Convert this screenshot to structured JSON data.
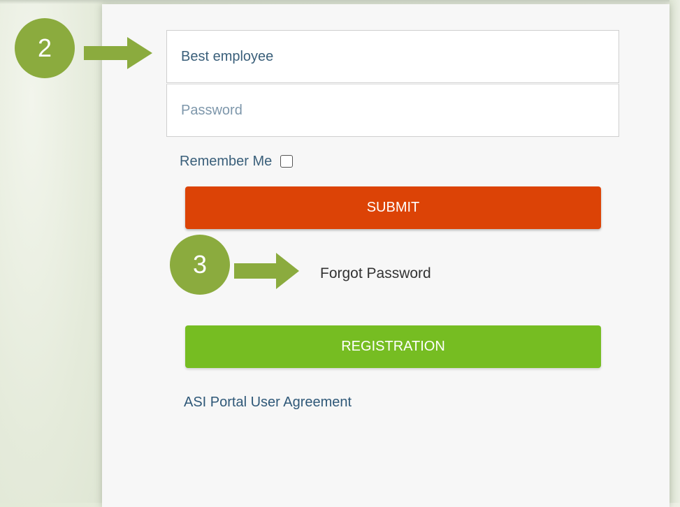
{
  "login_form": {
    "username_value": "Best employee",
    "password_placeholder": "Password",
    "remember_label": "Remember Me",
    "remember_checked": false,
    "submit_label": "SUBMIT",
    "forgot_label": "Forgot Password",
    "registration_label": "REGISTRATION",
    "agreement_label": "ASI Portal User Agreement"
  },
  "annotations": {
    "step_username": "2",
    "step_forgot": "3"
  },
  "colors": {
    "submit_button": "#dc4306",
    "registration_button": "#76bd22",
    "step_marker": "#8bab3e"
  },
  "icons": {
    "step_username_pointer": "arrow-right-icon",
    "step_forgot_pointer": "arrow-right-icon"
  }
}
